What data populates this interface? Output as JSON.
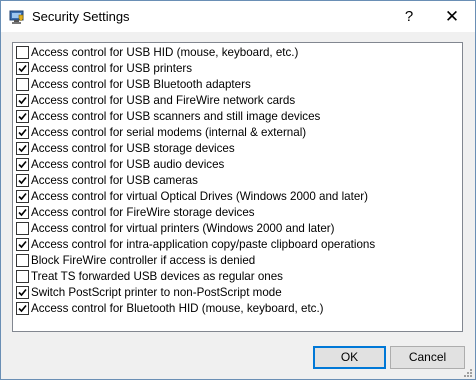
{
  "window": {
    "title": "Security Settings",
    "help_label": "?",
    "close_label": "✕"
  },
  "options": [
    {
      "label": "Access control for USB HID (mouse, keyboard, etc.)",
      "checked": false
    },
    {
      "label": "Access control for USB printers",
      "checked": true
    },
    {
      "label": "Access control for USB Bluetooth adapters",
      "checked": false
    },
    {
      "label": "Access control for USB and FireWire network cards",
      "checked": true
    },
    {
      "label": "Access control for USB scanners and still image devices",
      "checked": true
    },
    {
      "label": "Access control for serial modems (internal & external)",
      "checked": true
    },
    {
      "label": "Access control for USB storage devices",
      "checked": true
    },
    {
      "label": "Access control for USB audio devices",
      "checked": true
    },
    {
      "label": "Access control for USB cameras",
      "checked": true
    },
    {
      "label": "Access control for virtual Optical Drives (Windows 2000 and later)",
      "checked": true
    },
    {
      "label": "Access control for FireWire storage devices",
      "checked": true
    },
    {
      "label": "Access control for virtual printers (Windows 2000 and later)",
      "checked": false
    },
    {
      "label": "Access control for intra-application copy/paste clipboard operations",
      "checked": true
    },
    {
      "label": "Block FireWire controller if access is denied",
      "checked": false
    },
    {
      "label": "Treat TS forwarded USB devices as regular ones",
      "checked": false
    },
    {
      "label": "Switch PostScript printer to non-PostScript mode",
      "checked": true
    },
    {
      "label": "Access control for Bluetooth HID (mouse, keyboard, etc.)",
      "checked": true
    }
  ],
  "buttons": {
    "ok": "OK",
    "cancel": "Cancel"
  },
  "icons": {
    "app": "shield-computer-icon",
    "help": "help-icon",
    "close": "close-icon",
    "grip": "resize-grip-icon"
  },
  "colors": {
    "accent": "#0078d7",
    "check": "#000000"
  }
}
